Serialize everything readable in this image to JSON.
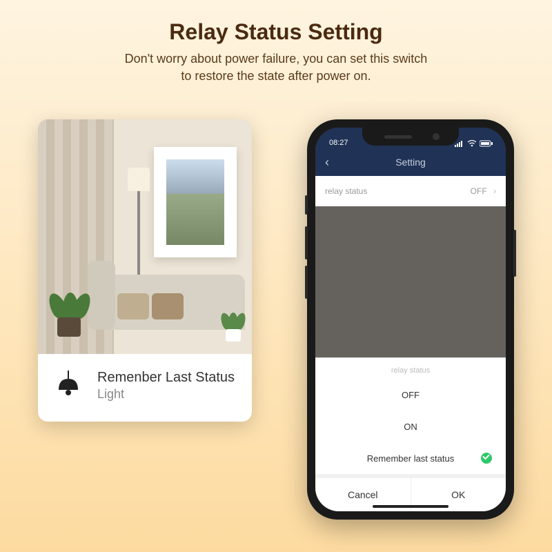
{
  "header": {
    "title": "Relay Status Setting",
    "subtitle_line1": "Don't worry about power failure, you can set this switch",
    "subtitle_line2": "to restore the state after power on."
  },
  "card": {
    "label_line1": "Remenber Last Status",
    "label_line2": "Light"
  },
  "phone": {
    "status_time": "08:27",
    "nav": {
      "back_glyph": "‹",
      "title": "Setting"
    },
    "row": {
      "label": "relay status",
      "value": "OFF",
      "chevron": "›"
    },
    "sheet": {
      "title": "relay status",
      "options": [
        "OFF",
        "ON",
        "Remember last status"
      ],
      "selected_index": 2,
      "cancel": "Cancel",
      "ok": "OK"
    }
  }
}
